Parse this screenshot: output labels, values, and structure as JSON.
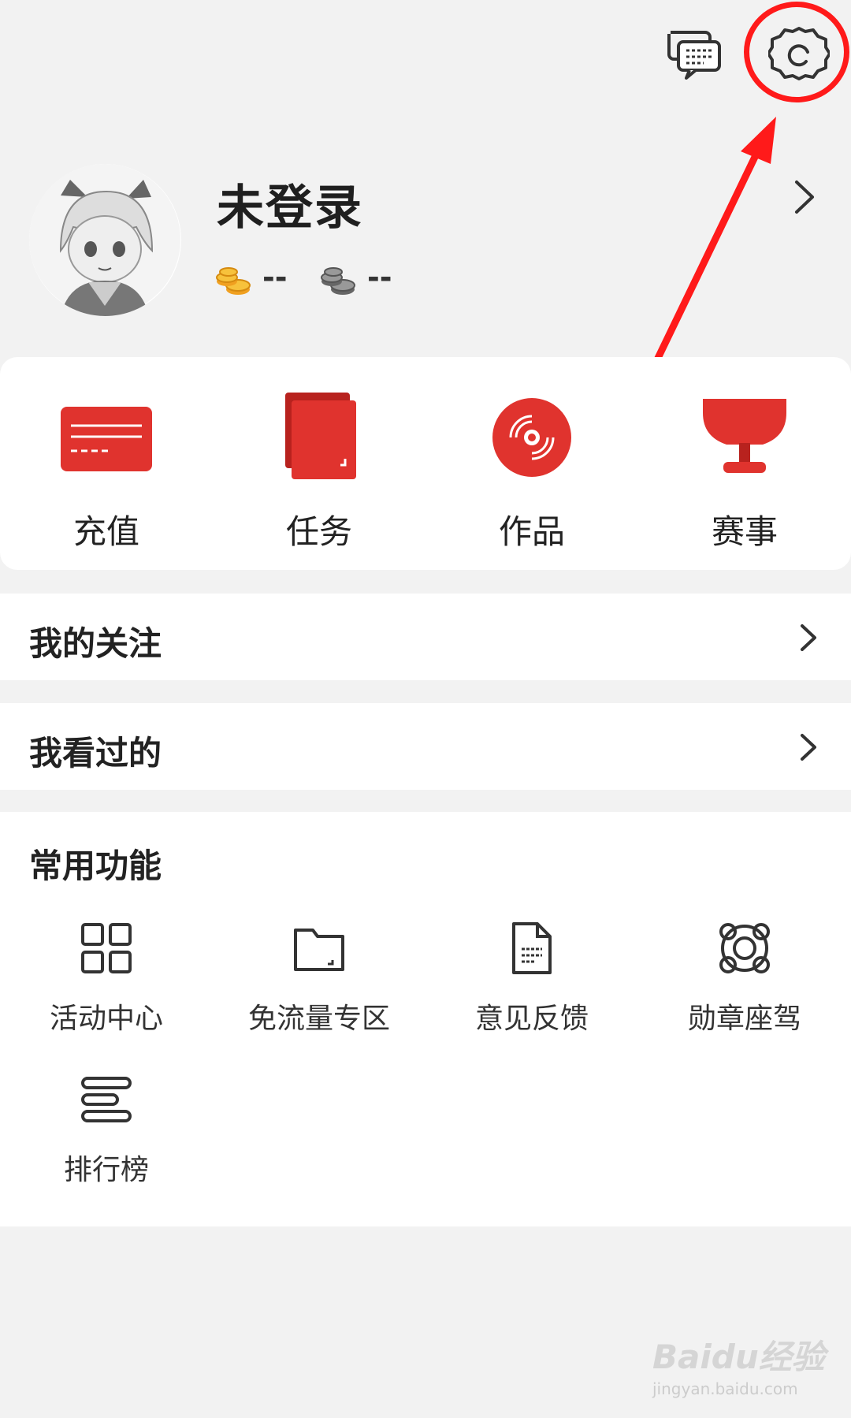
{
  "header": {
    "messages_icon": "chat-bubbles-icon",
    "settings_icon": "gear-icon"
  },
  "profile": {
    "username": "未登录",
    "gold_coins": "--",
    "silver_coins": "--"
  },
  "quick_actions": [
    {
      "label": "充值",
      "icon": "recharge-card-icon"
    },
    {
      "label": "任务",
      "icon": "task-icon"
    },
    {
      "label": "作品",
      "icon": "disc-icon"
    },
    {
      "label": "赛事",
      "icon": "trophy-icon"
    }
  ],
  "rows": {
    "following": "我的关注",
    "history": "我看过的"
  },
  "common_functions": {
    "title": "常用功能",
    "items": [
      {
        "label": "活动中心",
        "icon": "grid-icon"
      },
      {
        "label": "免流量专区",
        "icon": "folder-icon"
      },
      {
        "label": "意见反馈",
        "icon": "document-icon"
      },
      {
        "label": "勋章座驾",
        "icon": "lifebuoy-icon"
      },
      {
        "label": "排行榜",
        "icon": "list-icon"
      }
    ]
  },
  "watermark": {
    "brand": "Baidu经验",
    "url": "jingyan.baidu.com"
  },
  "colors": {
    "accent": "#e0332e",
    "annotation": "#ff1a1a",
    "background": "#f2f2f2"
  }
}
